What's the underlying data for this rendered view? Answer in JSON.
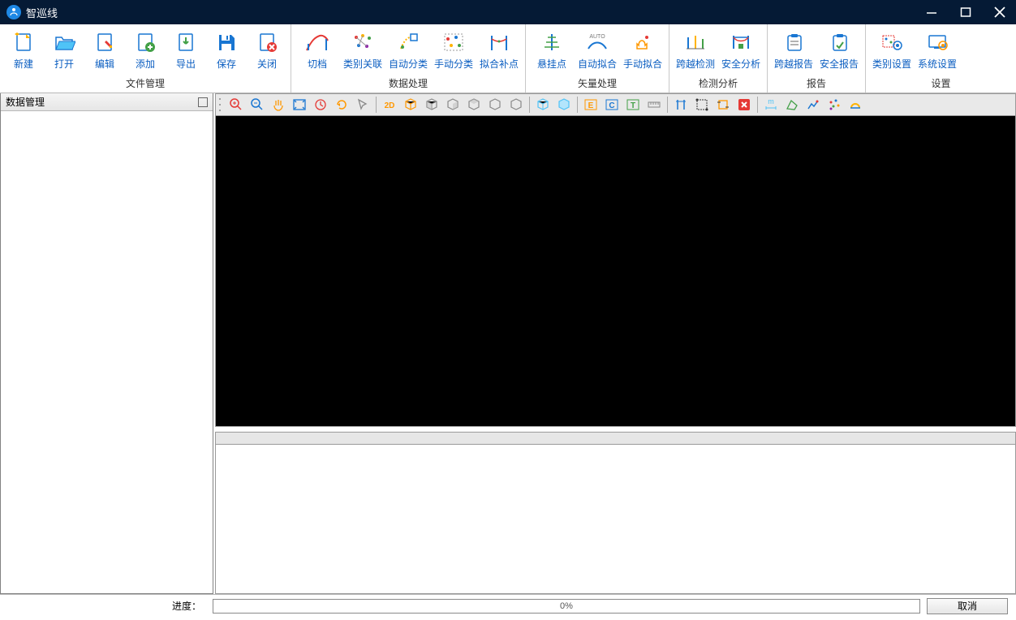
{
  "app": {
    "title": "智巡线"
  },
  "ribbon": {
    "groups": [
      {
        "label": "文件管理",
        "items": [
          "新建",
          "打开",
          "编辑",
          "添加",
          "导出",
          "保存",
          "关闭"
        ]
      },
      {
        "label": "数据处理",
        "items": [
          "切档",
          "类别关联",
          "自动分类",
          "手动分类",
          "拟合补点"
        ]
      },
      {
        "label": "矢量处理",
        "items": [
          "悬挂点",
          "自动拟合",
          "手动拟合"
        ]
      },
      {
        "label": "检测分析",
        "items": [
          "跨越检测",
          "安全分析"
        ]
      },
      {
        "label": "报告",
        "items": [
          "跨越报告",
          "安全报告"
        ]
      },
      {
        "label": "设置",
        "items": [
          "类别设置",
          "系统设置"
        ]
      }
    ]
  },
  "panels": {
    "data_mgmt": "数据管理"
  },
  "status": {
    "progress_label": "进度：",
    "progress_value": "0%",
    "cancel": "取消"
  }
}
